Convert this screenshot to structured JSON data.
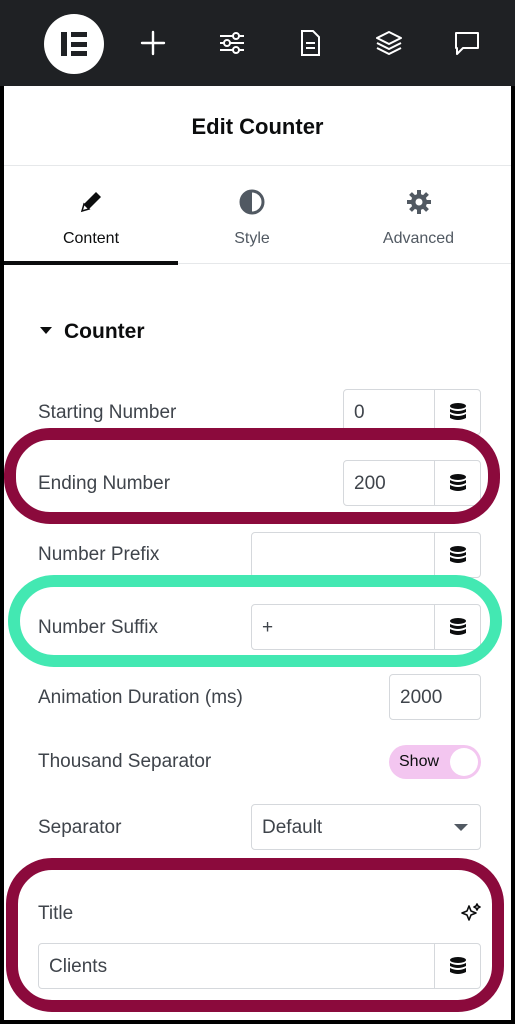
{
  "toolbar": {
    "icons": [
      "elementor-logo-icon",
      "plus-icon",
      "sliders-icon",
      "document-icon",
      "layers-icon",
      "comment-icon"
    ]
  },
  "panel": {
    "title": "Edit Counter"
  },
  "tabs": [
    {
      "label": "Content",
      "icon": "pencil-icon",
      "active": true
    },
    {
      "label": "Style",
      "icon": "half-circle-icon",
      "active": false
    },
    {
      "label": "Advanced",
      "icon": "gear-icon",
      "active": false
    }
  ],
  "section": {
    "title": "Counter"
  },
  "fields": {
    "starting_number": {
      "label": "Starting Number",
      "value": "0"
    },
    "ending_number": {
      "label": "Ending Number",
      "value": "200"
    },
    "number_prefix": {
      "label": "Number Prefix",
      "value": ""
    },
    "number_suffix": {
      "label": "Number Suffix",
      "value": "+"
    },
    "animation_duration": {
      "label": "Animation Duration (ms)",
      "value": "2000"
    },
    "thousand_separator": {
      "label": "Thousand Separator",
      "toggle_label": "Show"
    },
    "separator": {
      "label": "Separator",
      "value": "Default"
    },
    "title": {
      "label": "Title",
      "value": "Clients"
    }
  },
  "colors": {
    "highlight_red": "#8b0a3c",
    "highlight_green": "#43e8b2",
    "toggle_bg": "#f3c6f0",
    "toolbar_bg": "#1f2124"
  }
}
